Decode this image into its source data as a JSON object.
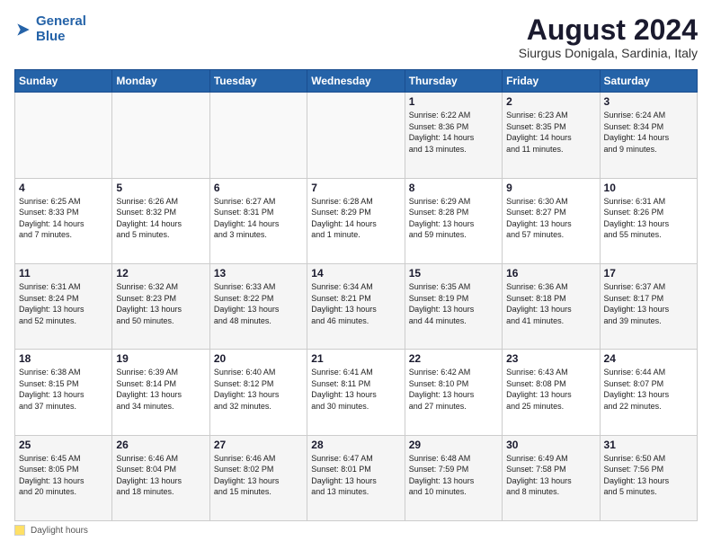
{
  "logo": {
    "line1": "General",
    "line2": "Blue"
  },
  "title": "August 2024",
  "location": "Siurgus Donigala, Sardinia, Italy",
  "days_of_week": [
    "Sunday",
    "Monday",
    "Tuesday",
    "Wednesday",
    "Thursday",
    "Friday",
    "Saturday"
  ],
  "weeks": [
    [
      {
        "day": "",
        "info": ""
      },
      {
        "day": "",
        "info": ""
      },
      {
        "day": "",
        "info": ""
      },
      {
        "day": "",
        "info": ""
      },
      {
        "day": "1",
        "info": "Sunrise: 6:22 AM\nSunset: 8:36 PM\nDaylight: 14 hours\nand 13 minutes."
      },
      {
        "day": "2",
        "info": "Sunrise: 6:23 AM\nSunset: 8:35 PM\nDaylight: 14 hours\nand 11 minutes."
      },
      {
        "day": "3",
        "info": "Sunrise: 6:24 AM\nSunset: 8:34 PM\nDaylight: 14 hours\nand 9 minutes."
      }
    ],
    [
      {
        "day": "4",
        "info": "Sunrise: 6:25 AM\nSunset: 8:33 PM\nDaylight: 14 hours\nand 7 minutes."
      },
      {
        "day": "5",
        "info": "Sunrise: 6:26 AM\nSunset: 8:32 PM\nDaylight: 14 hours\nand 5 minutes."
      },
      {
        "day": "6",
        "info": "Sunrise: 6:27 AM\nSunset: 8:31 PM\nDaylight: 14 hours\nand 3 minutes."
      },
      {
        "day": "7",
        "info": "Sunrise: 6:28 AM\nSunset: 8:29 PM\nDaylight: 14 hours\nand 1 minute."
      },
      {
        "day": "8",
        "info": "Sunrise: 6:29 AM\nSunset: 8:28 PM\nDaylight: 13 hours\nand 59 minutes."
      },
      {
        "day": "9",
        "info": "Sunrise: 6:30 AM\nSunset: 8:27 PM\nDaylight: 13 hours\nand 57 minutes."
      },
      {
        "day": "10",
        "info": "Sunrise: 6:31 AM\nSunset: 8:26 PM\nDaylight: 13 hours\nand 55 minutes."
      }
    ],
    [
      {
        "day": "11",
        "info": "Sunrise: 6:31 AM\nSunset: 8:24 PM\nDaylight: 13 hours\nand 52 minutes."
      },
      {
        "day": "12",
        "info": "Sunrise: 6:32 AM\nSunset: 8:23 PM\nDaylight: 13 hours\nand 50 minutes."
      },
      {
        "day": "13",
        "info": "Sunrise: 6:33 AM\nSunset: 8:22 PM\nDaylight: 13 hours\nand 48 minutes."
      },
      {
        "day": "14",
        "info": "Sunrise: 6:34 AM\nSunset: 8:21 PM\nDaylight: 13 hours\nand 46 minutes."
      },
      {
        "day": "15",
        "info": "Sunrise: 6:35 AM\nSunset: 8:19 PM\nDaylight: 13 hours\nand 44 minutes."
      },
      {
        "day": "16",
        "info": "Sunrise: 6:36 AM\nSunset: 8:18 PM\nDaylight: 13 hours\nand 41 minutes."
      },
      {
        "day": "17",
        "info": "Sunrise: 6:37 AM\nSunset: 8:17 PM\nDaylight: 13 hours\nand 39 minutes."
      }
    ],
    [
      {
        "day": "18",
        "info": "Sunrise: 6:38 AM\nSunset: 8:15 PM\nDaylight: 13 hours\nand 37 minutes."
      },
      {
        "day": "19",
        "info": "Sunrise: 6:39 AM\nSunset: 8:14 PM\nDaylight: 13 hours\nand 34 minutes."
      },
      {
        "day": "20",
        "info": "Sunrise: 6:40 AM\nSunset: 8:12 PM\nDaylight: 13 hours\nand 32 minutes."
      },
      {
        "day": "21",
        "info": "Sunrise: 6:41 AM\nSunset: 8:11 PM\nDaylight: 13 hours\nand 30 minutes."
      },
      {
        "day": "22",
        "info": "Sunrise: 6:42 AM\nSunset: 8:10 PM\nDaylight: 13 hours\nand 27 minutes."
      },
      {
        "day": "23",
        "info": "Sunrise: 6:43 AM\nSunset: 8:08 PM\nDaylight: 13 hours\nand 25 minutes."
      },
      {
        "day": "24",
        "info": "Sunrise: 6:44 AM\nSunset: 8:07 PM\nDaylight: 13 hours\nand 22 minutes."
      }
    ],
    [
      {
        "day": "25",
        "info": "Sunrise: 6:45 AM\nSunset: 8:05 PM\nDaylight: 13 hours\nand 20 minutes."
      },
      {
        "day": "26",
        "info": "Sunrise: 6:46 AM\nSunset: 8:04 PM\nDaylight: 13 hours\nand 18 minutes."
      },
      {
        "day": "27",
        "info": "Sunrise: 6:46 AM\nSunset: 8:02 PM\nDaylight: 13 hours\nand 15 minutes."
      },
      {
        "day": "28",
        "info": "Sunrise: 6:47 AM\nSunset: 8:01 PM\nDaylight: 13 hours\nand 13 minutes."
      },
      {
        "day": "29",
        "info": "Sunrise: 6:48 AM\nSunset: 7:59 PM\nDaylight: 13 hours\nand 10 minutes."
      },
      {
        "day": "30",
        "info": "Sunrise: 6:49 AM\nSunset: 7:58 PM\nDaylight: 13 hours\nand 8 minutes."
      },
      {
        "day": "31",
        "info": "Sunrise: 6:50 AM\nSunset: 7:56 PM\nDaylight: 13 hours\nand 5 minutes."
      }
    ]
  ],
  "footer": {
    "note": "Daylight hours"
  }
}
